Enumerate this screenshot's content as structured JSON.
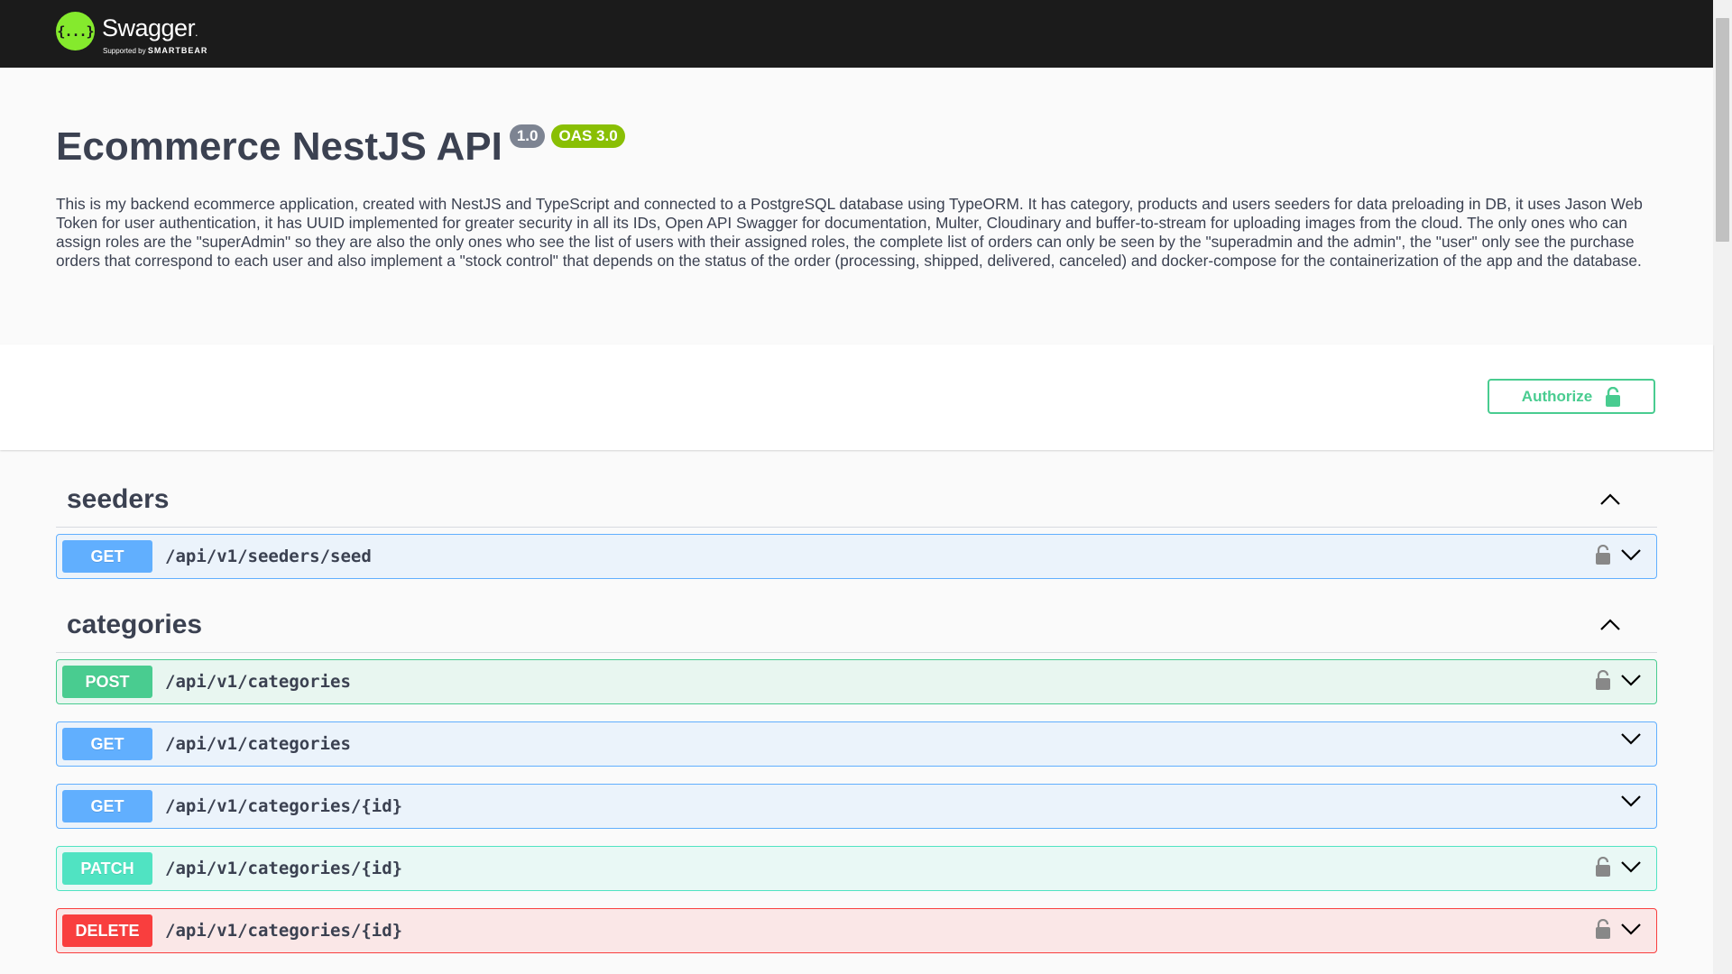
{
  "topbar": {
    "logo_glyph": "{...}",
    "logo_name": "Swagger",
    "logo_trademark": ".",
    "logo_sub_prefix": "Supported by",
    "logo_sub_brand": "SMARTBEAR"
  },
  "info": {
    "title": "Ecommerce NestJS API",
    "version": "1.0",
    "oas": "OAS 3.0",
    "description": "This is my backend ecommerce application, created with NestJS and TypeScript and connected to a PostgreSQL database using TypeORM. It has category, products and users seeders for data preloading in DB, it uses Jason Web Token for user authentication, it has UUID implemented for greater security in all its IDs, Open API Swagger for documentation, Multer, Cloudinary and buffer-to-stream for uploading images from the cloud. The only ones who can assign roles are the \"superAdmin\" so they are also the only ones who see the list of users with their assigned roles, the complete list of orders can only be seen by the \"superadmin and the admin\", the \"user\" only see the purchase orders that correspond to each user and also implement a \"stock control\" that depends on the status of the order (processing, shipped, delivered, canceled) and docker-compose for the containerization of the app and the database."
  },
  "authorize": {
    "label": "Authorize",
    "icon": "unlock-icon"
  },
  "colors": {
    "get": "#61affe",
    "post": "#49cc90",
    "patch": "#50e3c2",
    "delete": "#f93e3e",
    "topbar": "#1b1b1b",
    "logo": "#85ea2d"
  },
  "tags": [
    {
      "name": "seeders",
      "operations": [
        {
          "method": "GET",
          "path": "/api/v1/seeders/seed",
          "locked": true
        }
      ]
    },
    {
      "name": "categories",
      "operations": [
        {
          "method": "POST",
          "path": "/api/v1/categories",
          "locked": true
        },
        {
          "method": "GET",
          "path": "/api/v1/categories",
          "locked": false
        },
        {
          "method": "GET",
          "path": "/api/v1/categories/{id}",
          "locked": false
        },
        {
          "method": "PATCH",
          "path": "/api/v1/categories/{id}",
          "locked": true
        },
        {
          "method": "DELETE",
          "path": "/api/v1/categories/{id}",
          "locked": true
        }
      ]
    }
  ]
}
